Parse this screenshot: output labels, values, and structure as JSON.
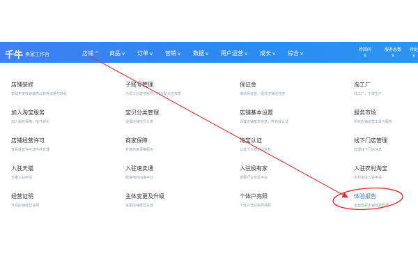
{
  "header": {
    "logo": "千牛",
    "subtitle": "卖家工作台",
    "nav": [
      {
        "label": "店铺",
        "chevron": "^"
      },
      {
        "label": "商品",
        "chevron": "v"
      },
      {
        "label": "订单",
        "chevron": "v"
      },
      {
        "label": "营销",
        "chevron": "v"
      },
      {
        "label": "数据",
        "chevron": "v"
      },
      {
        "label": "用户运营",
        "chevron": "v"
      },
      {
        "label": "成长",
        "chevron": "v"
      },
      {
        "label": "综合",
        "chevron": "v"
      }
    ],
    "stats": [
      {
        "label": "待回问",
        "value": "5"
      },
      {
        "label": "服务总数",
        "value": "5"
      },
      {
        "label": "待处",
        "value": "5"
      }
    ]
  },
  "menu": [
    {
      "title": "店铺装修",
      "desc": "帮助卖家快速装修以获得流量与转化"
    },
    {
      "title": "子账号管理",
      "desc": "为员工创建子账号，并分配对应权限"
    },
    {
      "title": "保证金",
      "desc": "缴纳保证金，提升店铺信任度"
    },
    {
      "title": "淘工厂",
      "desc": "找工厂，下单生产"
    },
    {
      "title": "加入淘宝服务",
      "desc": "加入服务保障，提升转化"
    },
    {
      "title": "宝贝分类管理",
      "desc": "设置店铺宝贝分类"
    },
    {
      "title": "店铺基本设置",
      "desc": "设置店铺基本信息，并完成认证"
    },
    {
      "title": "服务市场",
      "desc": "购买店铺运营工具与服务"
    },
    {
      "title": "店铺经营许可",
      "desc": "查看经营许可证件并管理"
    },
    {
      "title": "商家保障",
      "desc": "开通商家保障服务"
    },
    {
      "title": "淘宝认证",
      "desc": "认证个人或企业信息"
    },
    {
      "title": "线下门店管理",
      "desc": "管理线下门店信息"
    },
    {
      "title": "入驻天猫",
      "desc": "天猫入驻申请"
    },
    {
      "title": "入驻速卖通",
      "desc": "跨境电商出海平台"
    },
    {
      "title": "入驻极有家",
      "desc": "家居行业专属平台"
    },
    {
      "title": "入驻农村淘宝",
      "desc": "农村淘宝入驻申请"
    },
    {
      "title": "经营证明",
      "desc": "开具店铺经营证明"
    },
    {
      "title": "主体变更及升级",
      "desc": "变更店铺经营主体"
    },
    {
      "title": "个体户亮照",
      "desc": "个体户营业执照亮照"
    },
    {
      "title": "体验报告",
      "desc": "全面查看店铺体验数据"
    }
  ],
  "colors": {
    "annotation": "#e03030",
    "accent": "#2e86f0"
  }
}
